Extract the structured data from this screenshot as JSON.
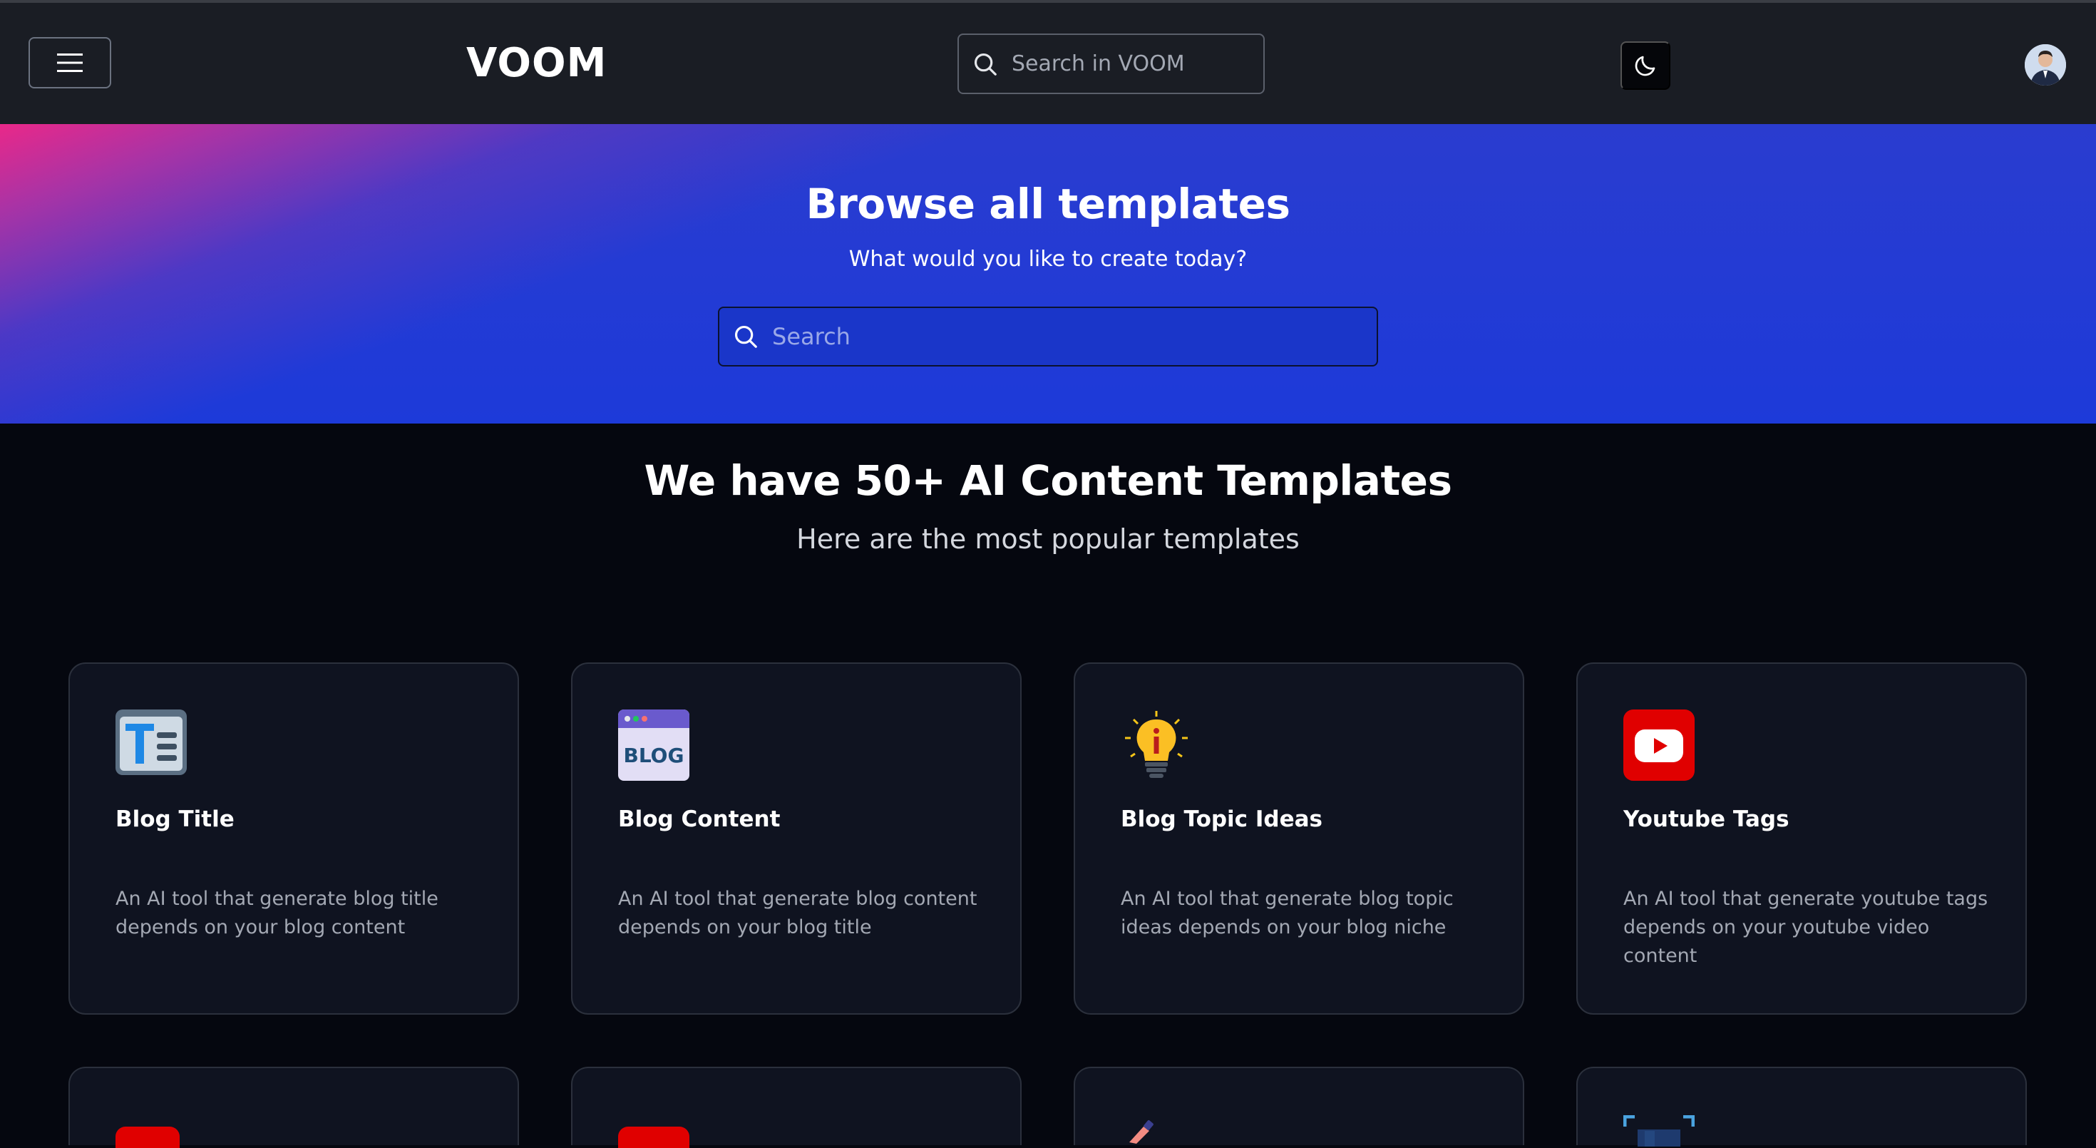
{
  "header": {
    "logo": "VOOM",
    "search_placeholder": "Search in VOOM"
  },
  "hero": {
    "title": "Browse all templates",
    "subtitle": "What would you like to create today?",
    "search_placeholder": "Search"
  },
  "section": {
    "title": "We have 50+ AI Content Templates",
    "subtitle": "Here are the most popular templates"
  },
  "templates": [
    {
      "title": "Blog Title",
      "description": "An AI tool that generate blog title depends on your blog content",
      "icon": "text-title-icon"
    },
    {
      "title": "Blog Content",
      "description": "An AI tool that generate blog content depends on your blog title",
      "icon": "blog-window-icon"
    },
    {
      "title": "Blog Topic Ideas",
      "description": "An AI tool that generate blog topic ideas depends on your blog niche",
      "icon": "lightbulb-icon"
    },
    {
      "title": "Youtube Tags",
      "description": "An AI tool that generate youtube tags depends on your youtube video content",
      "icon": "youtube-icon"
    }
  ],
  "colors": {
    "accent_blue": "#1d3ad9",
    "accent_pink": "#e92889",
    "background": "#05070f",
    "card": "#0f1320"
  }
}
